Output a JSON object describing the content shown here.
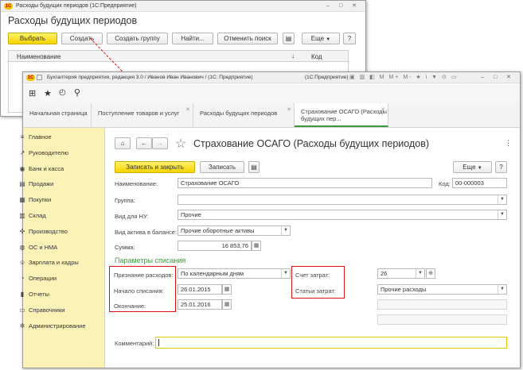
{
  "back_window": {
    "title": "Расходы будущих периодов (1С:Предприятие)",
    "heading": "Расходы будущих периодов",
    "buttons": {
      "select": "Выбрать",
      "create": "Создать",
      "create_group": "Создать группу",
      "find": "Найти...",
      "cancel_search": "Отменить поиск",
      "more": "Еще",
      "help": "?"
    },
    "columns": {
      "name": "Наименование",
      "sort": "↓",
      "code": "Код"
    }
  },
  "main_window": {
    "title": "Бухгалтерия предприятия, редакция 3.0 / Иванов Иван Иванович / (1С:Предприятие)",
    "title_app": "(1С:Предприятие)",
    "tabs": [
      {
        "label": "Начальная страница"
      },
      {
        "label": "Поступление товаров и услуг"
      },
      {
        "label": "Расходы будущих периодов"
      },
      {
        "label": "Страхование ОСАГО (Расходы будущих пер..."
      }
    ],
    "sidebar": [
      {
        "label": "Главное",
        "icon": "≡"
      },
      {
        "label": "Руководителю",
        "icon": "↗"
      },
      {
        "label": "Банк и касса",
        "icon": "◉"
      },
      {
        "label": "Продажи",
        "icon": "▤"
      },
      {
        "label": "Покупки",
        "icon": "▦"
      },
      {
        "label": "Склад",
        "icon": "▥"
      },
      {
        "label": "Производство",
        "icon": "✣"
      },
      {
        "label": "ОС и НМА",
        "icon": "◍"
      },
      {
        "label": "Зарплата и кадры",
        "icon": "☺"
      },
      {
        "label": "Операции",
        "icon": "◔"
      },
      {
        "label": "Отчеты",
        "icon": "▮"
      },
      {
        "label": "Справочники",
        "icon": "▭"
      },
      {
        "label": "Администрирование",
        "icon": "✲"
      }
    ]
  },
  "form": {
    "title": "Страхование ОСАГО (Расходы будущих периодов)",
    "save_close": "Записать и закрыть",
    "save": "Записать",
    "more": "Еще",
    "help": "?",
    "name_label": "Наименование:",
    "name_value": "Страхование ОСАГО",
    "code_label": "Код:",
    "code_value": "00-000003",
    "group_label": "Группа:",
    "group_value": "",
    "vid_nu_label": "Вид для НУ:",
    "vid_nu_value": "Прочие",
    "vid_aktiva_label": "Вид актива в балансе:",
    "vid_aktiva_value": "Прочие оборотные активы",
    "summa_label": "Сумма:",
    "summa_value": "16 853,76",
    "section_title": "Параметры списания",
    "priznanie_label": "Признание расходов:",
    "priznanie_value": "По календарным дням",
    "nachalo_label": "Начало списания:",
    "nachalo_value": "26.01.2015",
    "okonchanie_label": "Окончание:",
    "okonchanie_value": "25.01.2016",
    "schet_label": "Счет затрат:",
    "schet_value": "26",
    "stati_label": "Статьи затрат:",
    "stati_value": "Прочие расходы",
    "comment_label": "Комментарий:",
    "comment_value": ""
  },
  "colors": {
    "accent_yellow": "#f4d300",
    "sidebar_bg": "#fbf2b8",
    "highlight_red": "#e01010",
    "section_green": "#3c9a3c"
  }
}
